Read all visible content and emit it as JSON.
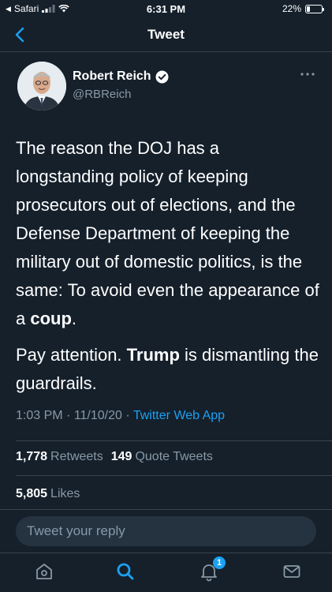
{
  "status_bar": {
    "carrier": "Safari",
    "time": "6:31 PM",
    "battery_percent": "22%",
    "battery_level": 0.22
  },
  "nav": {
    "title": "Tweet"
  },
  "author": {
    "name": "Robert Reich",
    "handle": "@RBReich",
    "verified": true
  },
  "tweet": {
    "para1_a": "The reason the DOJ has a longstanding policy of keeping prosecutors out of elections, and the Defense Department of keeping the military out of domestic politics, is the same: To avoid even the appearance of a ",
    "para1_bold": "coup",
    "para1_end": ".",
    "para2_a": "Pay attention. ",
    "para2_bold": "Trump",
    "para2_b": " is dismantling the guardrails."
  },
  "meta": {
    "time": "1:03 PM",
    "sep1": " · ",
    "date": "11/10/20",
    "sep2": " · ",
    "source": "Twitter Web App"
  },
  "stats": {
    "retweets_count": "1,778",
    "retweets_label": "Retweets",
    "quote_count": "149",
    "quote_label": "Quote Tweets",
    "likes_count": "5,805",
    "likes_label": "Likes"
  },
  "reply": {
    "placeholder": "Tweet your reply"
  },
  "tab_bar": {
    "notifications_badge": "1"
  },
  "colors": {
    "background": "#15202b",
    "accent": "#1da1f2",
    "secondary_text": "#8899a6",
    "divider": "#38444d"
  },
  "icons": [
    "back-chevron-icon",
    "verified-badge-icon",
    "more-dots-icon",
    "home-icon",
    "search-icon",
    "notifications-bell-icon",
    "messages-envelope-icon",
    "signal-icon",
    "wifi-icon",
    "battery-icon"
  ]
}
